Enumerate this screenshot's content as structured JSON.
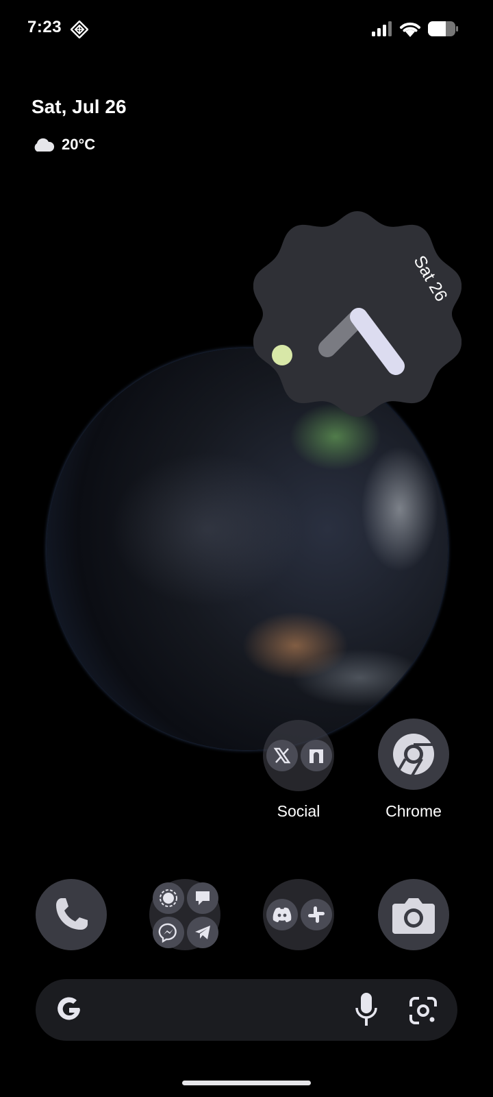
{
  "status_bar": {
    "time": "7:23",
    "icons": [
      "notification-diamond-icon",
      "cellular-signal-icon",
      "wifi-icon",
      "battery-icon"
    ]
  },
  "at_a_glance": {
    "date": "Sat, Jul 26",
    "weather_icon": "cloud-icon",
    "temperature": "20°C"
  },
  "clock_widget": {
    "date_label": "Sat 26",
    "colors": {
      "face": "#2f3036",
      "hour_hand": "#7a7b82",
      "minute_hand": "#dcdcf0",
      "dot": "#d8e8a8"
    }
  },
  "apps": {
    "social_folder": {
      "label": "Social",
      "icons": [
        "x-icon",
        "threads-icon"
      ]
    },
    "chrome": {
      "label": "Chrome",
      "icon": "chrome-icon"
    }
  },
  "dock": {
    "items": [
      {
        "name": "phone",
        "icon": "phone-icon"
      },
      {
        "name": "messaging-folder",
        "icons": [
          "signal-icon",
          "google-chat-icon",
          "messenger-icon",
          "telegram-icon"
        ]
      },
      {
        "name": "work-folder",
        "icons": [
          "discord-icon",
          "slack-icon"
        ]
      },
      {
        "name": "camera",
        "icon": "camera-icon"
      }
    ]
  },
  "search_bar": {
    "icons": [
      "google-g-icon",
      "microphone-icon",
      "google-lens-icon"
    ]
  },
  "wallpaper": "earth-globe"
}
